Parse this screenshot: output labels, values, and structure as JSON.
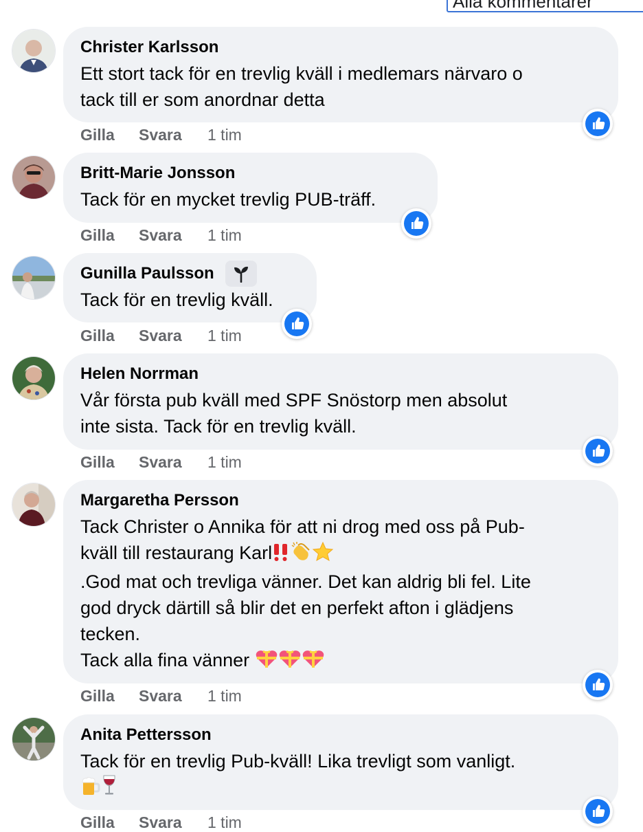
{
  "header": {
    "filter_label": "Alla kommentarer"
  },
  "actions": {
    "like_label": "Gilla",
    "reply_label": "Svara"
  },
  "colors": {
    "bubble": "#f0f2f5",
    "like_blue": "#1877f2",
    "meta_gray": "#65676b"
  },
  "comments": [
    {
      "author": "Christer Karlsson",
      "text": "Ett stort tack för en trevlig kväll i medlemars närvaro o\ntack till er som anordnar detta",
      "time": "1 tim",
      "reaction": "like-icon"
    },
    {
      "author": "Britt-Marie Jonsson",
      "text": "Tack för en mycket trevlig PUB-träff.",
      "time": "1 tim",
      "reaction": "like-icon"
    },
    {
      "author": "Gunilla Paulsson",
      "badge_icon": "sprout-badge-icon",
      "text": "Tack för en trevlig kväll.",
      "time": "1 tim",
      "reaction": "like-icon"
    },
    {
      "author": "Helen Norrman",
      "text": "Vår första pub kväll med SPF Snöstorp men absolut\ninte sista. Tack för en trevlig kväll.",
      "time": "1 tim",
      "reaction": "like-icon"
    },
    {
      "author": "Margaretha Persson",
      "text_line1": "Tack Christer o Annika för att ni drog med oss på Pub-",
      "text_line2": "kväll till restaurang Karl",
      "text_rest": ".God mat och trevliga vänner. Det kan aldrig bli fel. Lite\ngod dryck därtill så blir det en perfekt afton i glädjens\ntecken.",
      "text_last": "Tack alla fina vänner ",
      "emojis_line2": [
        "double-exclamation-emoji",
        "clapping-hands-emoji",
        "star-emoji"
      ],
      "emojis_last": [
        "heart-gift-emoji",
        "heart-gift-emoji",
        "heart-gift-emoji"
      ],
      "time": "1 tim",
      "reaction": "like-icon"
    },
    {
      "author": "Anita Pettersson",
      "text": "Tack för en trevlig Pub-kväll! Lika trevligt som vanligt.",
      "emojis": [
        "beer-mug-emoji",
        "wine-glass-emoji"
      ],
      "time": "1 tim",
      "reaction": "like-icon"
    }
  ]
}
